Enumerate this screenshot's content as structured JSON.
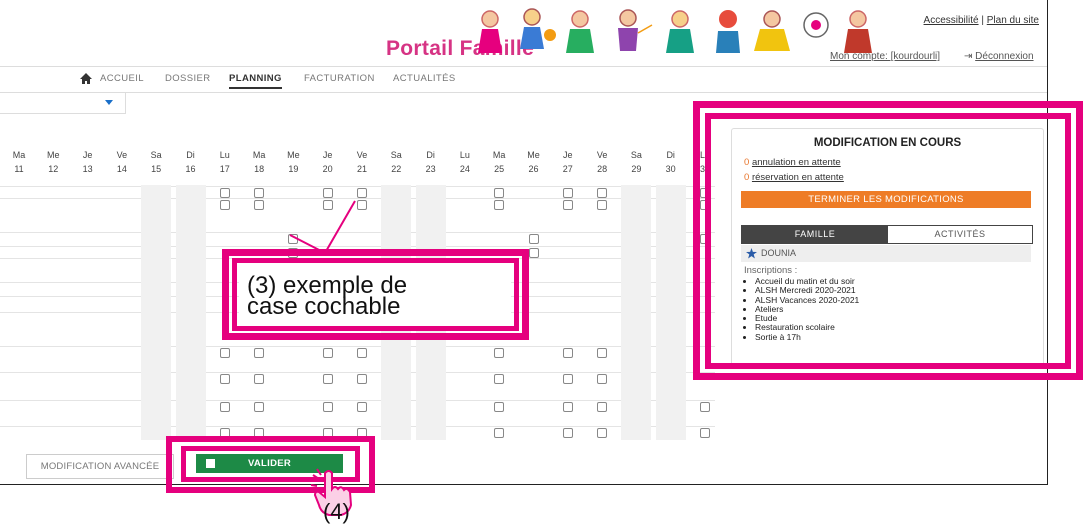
{
  "header": {
    "brand": "Portail Famille",
    "accessibility": "Accessibilité",
    "sitemap": "Plan du site",
    "separator": "|",
    "account": "Mon compte: [kourdourli]",
    "logout": "Déconnexion",
    "images": "kids-illustration"
  },
  "nav": {
    "items": [
      "ACCUEIL",
      "DOSSIER",
      "PLANNING",
      "FACTURATION",
      "ACTUALITÉS"
    ],
    "active": "PLANNING"
  },
  "calendar": {
    "days": [
      {
        "d": "Ma",
        "n": "11"
      },
      {
        "d": "Me",
        "n": "12"
      },
      {
        "d": "Je",
        "n": "13"
      },
      {
        "d": "Ve",
        "n": "14"
      },
      {
        "d": "Sa",
        "n": "15"
      },
      {
        "d": "Di",
        "n": "16"
      },
      {
        "d": "Lu",
        "n": "17"
      },
      {
        "d": "Ma",
        "n": "18"
      },
      {
        "d": "Me",
        "n": "19"
      },
      {
        "d": "Je",
        "n": "20"
      },
      {
        "d": "Ve",
        "n": "21"
      },
      {
        "d": "Sa",
        "n": "22"
      },
      {
        "d": "Di",
        "n": "23"
      },
      {
        "d": "Lu",
        "n": "24"
      },
      {
        "d": "Ma",
        "n": "25"
      },
      {
        "d": "Me",
        "n": "26"
      },
      {
        "d": "Je",
        "n": "27"
      },
      {
        "d": "Ve",
        "n": "28"
      },
      {
        "d": "Sa",
        "n": "29"
      },
      {
        "d": "Di",
        "n": "30"
      },
      {
        "d": "Lu",
        "n": "31"
      }
    ]
  },
  "panel": {
    "title": "MODIFICATION EN COURS",
    "cancel_count": "0",
    "cancel_text": "annulation en attente",
    "reserve_count": "0",
    "reserve_text": "réservation en attente",
    "finish_button": "TERMINER LES MODIFICATIONS",
    "tab_family": "FAMILLE",
    "tab_activities": "ACTIVITÉS",
    "member": "DOUNIA",
    "inscriptions_label": "Inscriptions :",
    "inscriptions": [
      "Accueil du matin et du soir",
      "ALSH Mercredi 2020-2021",
      "ALSH Vacances 2020-2021",
      "Ateliers",
      "Etude",
      "Restauration scolaire",
      "Sortie à 17h"
    ]
  },
  "annotations": {
    "callout_line1": "(3) exemple de",
    "callout_line2": "case cochable",
    "step4": "(4)",
    "highlight_color": "#e5007e"
  },
  "footer": {
    "advanced": "MODIFICATION AVANCÉE",
    "validate": "VALIDER"
  }
}
